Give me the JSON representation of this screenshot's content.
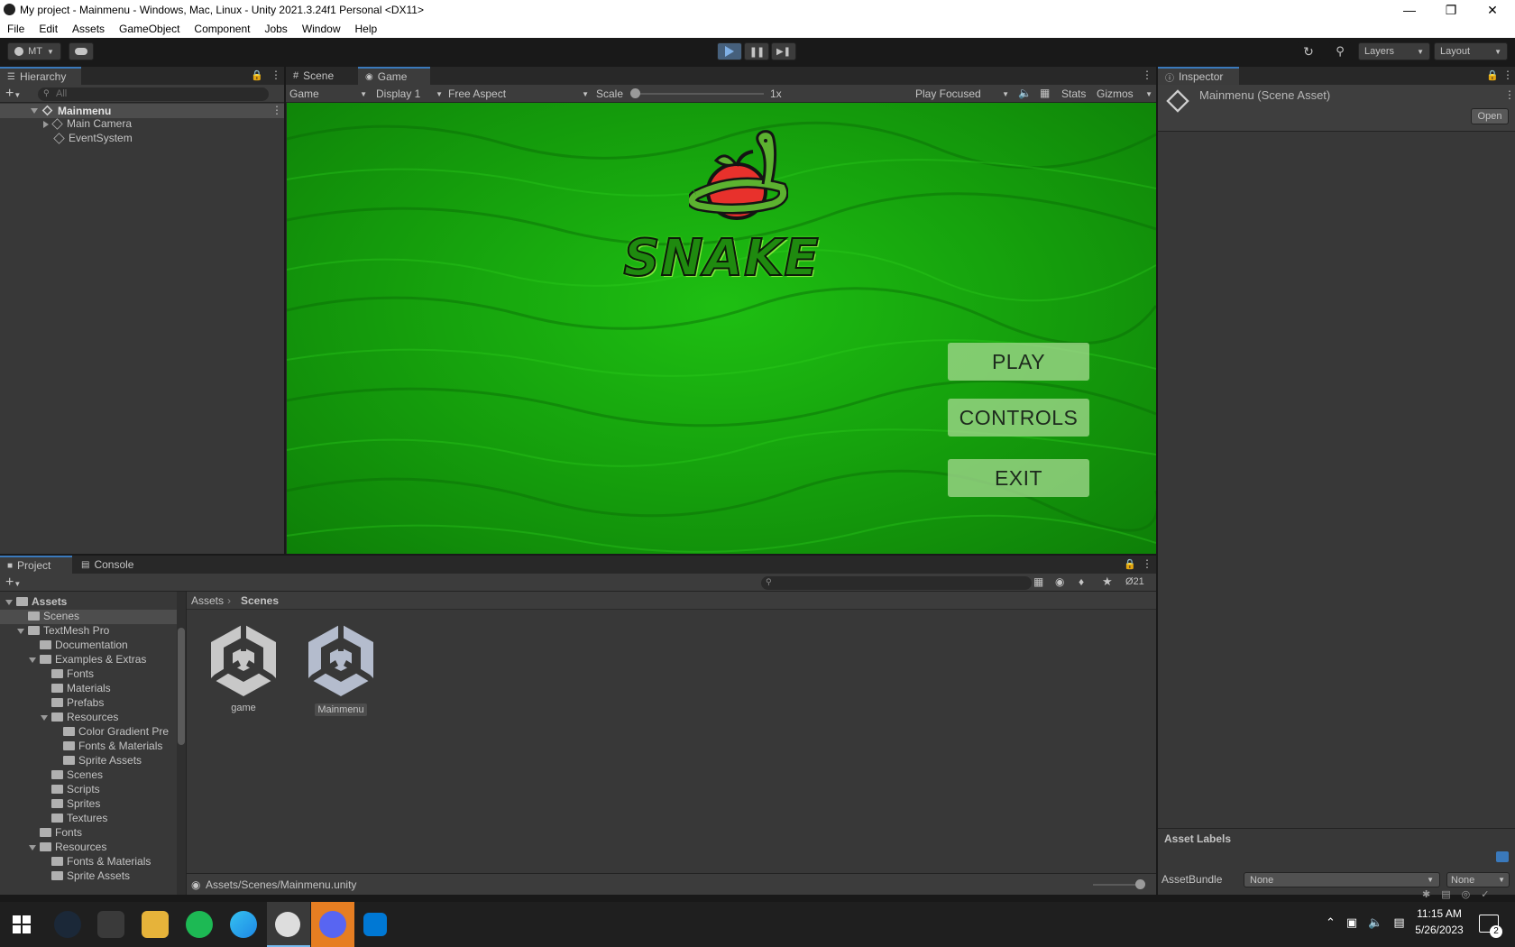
{
  "window": {
    "title": "My project - Mainmenu - Windows, Mac, Linux - Unity 2021.3.24f1 Personal <DX11>"
  },
  "menu": [
    "File",
    "Edit",
    "Assets",
    "GameObject",
    "Component",
    "Jobs",
    "Window",
    "Help"
  ],
  "toolbar": {
    "account": "MT",
    "layers": "Layers",
    "layout": "Layout"
  },
  "hierarchy": {
    "tab": "Hierarchy",
    "search_placeholder": "All",
    "scene": "Mainmenu",
    "items": [
      "Main Camera",
      "EventSystem"
    ]
  },
  "view_tabs": {
    "scene": "Scene",
    "game": "Game"
  },
  "game_toolbar": {
    "mode": "Game",
    "display": "Display 1",
    "aspect": "Free Aspect",
    "scale_label": "Scale",
    "scale_value": "1x",
    "play_mode": "Play Focused",
    "stats": "Stats",
    "gizmos": "Gizmos"
  },
  "game": {
    "title": "SNAKE",
    "buttons": [
      "PLAY",
      "CONTROLS",
      "EXIT"
    ],
    "colors": {
      "grass": "#17a10f",
      "button": "#a0d78c"
    }
  },
  "inspector": {
    "tab": "Inspector",
    "asset": "Mainmenu (Scene Asset)",
    "open": "Open",
    "asset_labels": "Asset Labels",
    "assetbundle_label": "AssetBundle",
    "assetbundle_value": "None",
    "variant_value": "None"
  },
  "project": {
    "tabs": [
      "Project",
      "Console"
    ],
    "hidden_count": "21",
    "breadcrumb": [
      "Assets",
      "Scenes"
    ],
    "tree": [
      {
        "label": "Assets",
        "depth": 0,
        "arrow": "down",
        "bold": true
      },
      {
        "label": "Scenes",
        "depth": 1,
        "arrow": "none",
        "selected": true
      },
      {
        "label": "TextMesh Pro",
        "depth": 1,
        "arrow": "down"
      },
      {
        "label": "Documentation",
        "depth": 2,
        "arrow": "none"
      },
      {
        "label": "Examples & Extras",
        "depth": 2,
        "arrow": "down"
      },
      {
        "label": "Fonts",
        "depth": 3,
        "arrow": "none"
      },
      {
        "label": "Materials",
        "depth": 3,
        "arrow": "none"
      },
      {
        "label": "Prefabs",
        "depth": 3,
        "arrow": "none"
      },
      {
        "label": "Resources",
        "depth": 3,
        "arrow": "down"
      },
      {
        "label": "Color Gradient Pre",
        "depth": 4,
        "arrow": "none"
      },
      {
        "label": "Fonts & Materials",
        "depth": 4,
        "arrow": "none"
      },
      {
        "label": "Sprite Assets",
        "depth": 4,
        "arrow": "none"
      },
      {
        "label": "Scenes",
        "depth": 3,
        "arrow": "none"
      },
      {
        "label": "Scripts",
        "depth": 3,
        "arrow": "none"
      },
      {
        "label": "Sprites",
        "depth": 3,
        "arrow": "none"
      },
      {
        "label": "Textures",
        "depth": 3,
        "arrow": "none"
      },
      {
        "label": "Fonts",
        "depth": 2,
        "arrow": "none"
      },
      {
        "label": "Resources",
        "depth": 2,
        "arrow": "down"
      },
      {
        "label": "Fonts & Materials",
        "depth": 3,
        "arrow": "none"
      },
      {
        "label": "Sprite Assets",
        "depth": 3,
        "arrow": "none"
      }
    ],
    "assets": [
      "game",
      "Mainmenu"
    ],
    "path": "Assets/Scenes/Mainmenu.unity"
  },
  "taskbar": {
    "time": "11:15 AM",
    "date": "5/26/2023",
    "notifications": "2"
  }
}
